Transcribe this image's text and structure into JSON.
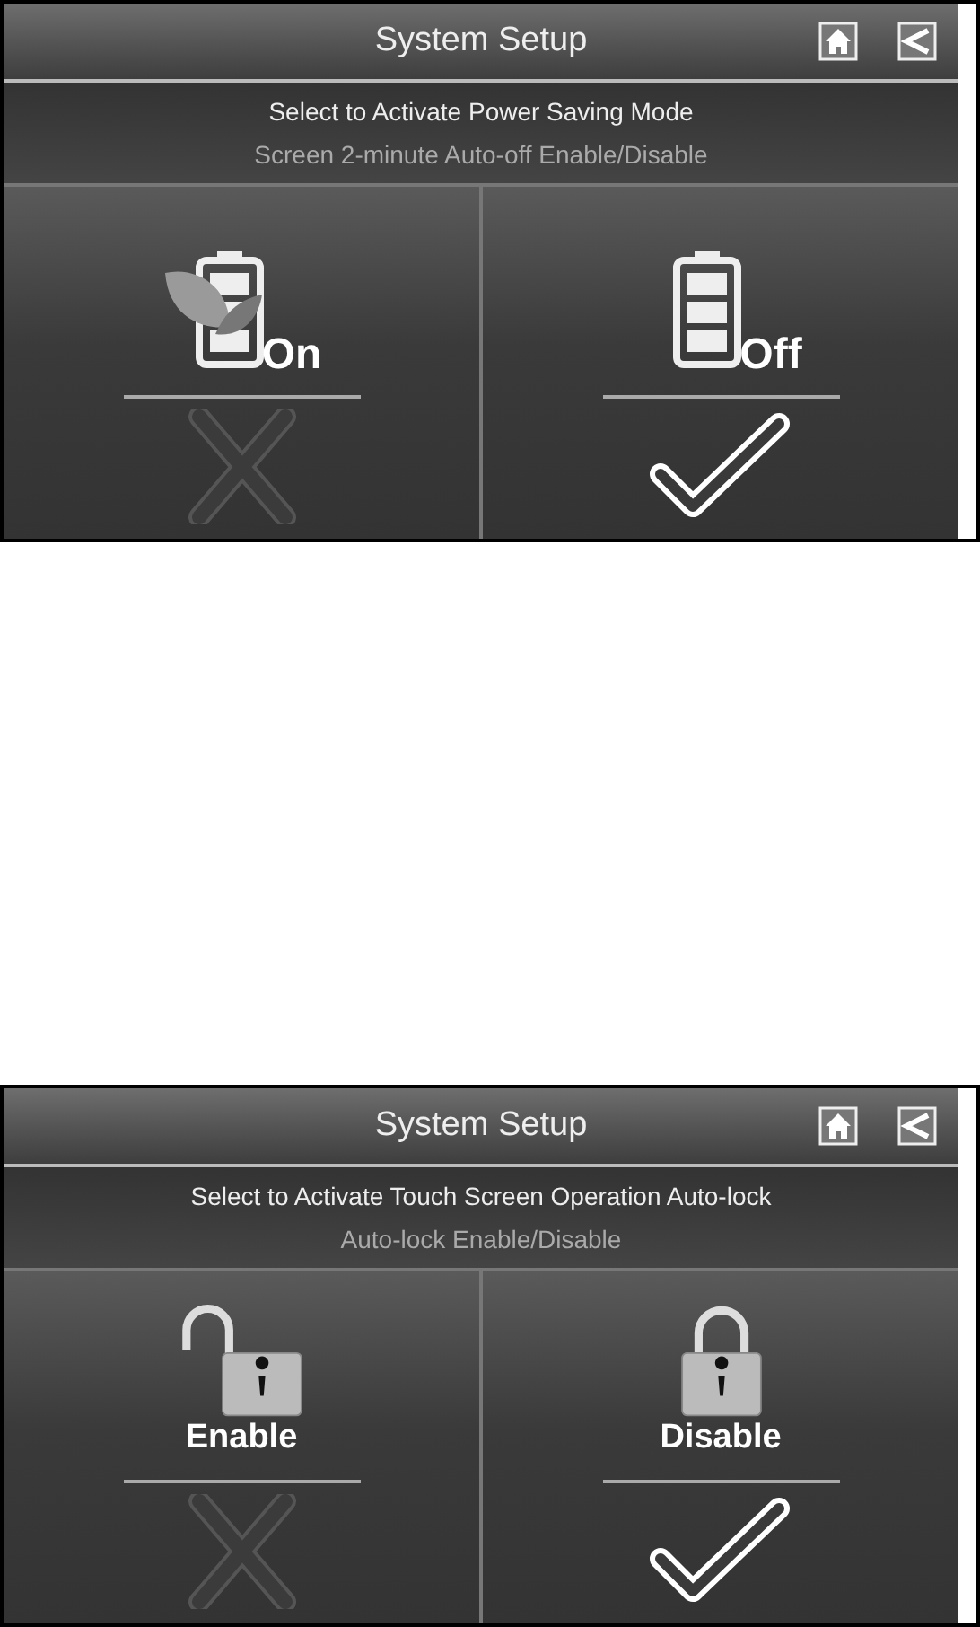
{
  "screens": [
    {
      "title": "System Setup",
      "instruction": "Select to Activate Power Saving Mode",
      "note": "Screen 2-minute Auto-off Enable/Disable",
      "options": [
        {
          "label": "On",
          "kind": "battery-leaf",
          "selected": false
        },
        {
          "label": "Off",
          "kind": "battery",
          "selected": true
        }
      ]
    },
    {
      "title": "System Setup",
      "instruction": "Select to Activate Touch Screen Operation Auto-lock",
      "note": "Auto-lock Enable/Disable",
      "options": [
        {
          "label": "Enable",
          "kind": "lock-open",
          "selected": false
        },
        {
          "label": "Disable",
          "kind": "lock-closed",
          "selected": true
        }
      ]
    }
  ]
}
